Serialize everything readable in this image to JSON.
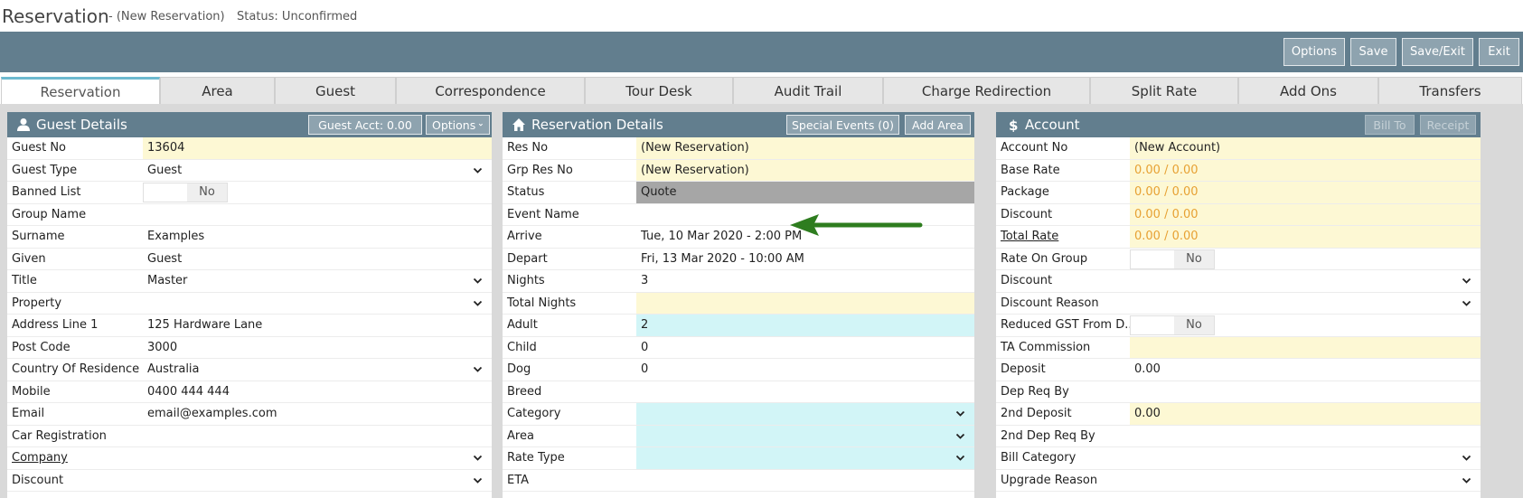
{
  "header": {
    "title": "Reservation",
    "subtitle": "- (New Reservation)",
    "status": "Status: Unconfirmed"
  },
  "toolbar": {
    "options": "Options",
    "save": "Save",
    "save_exit": "Save/Exit",
    "exit": "Exit"
  },
  "tabs": [
    "Reservation",
    "Area",
    "Guest",
    "Correspondence",
    "Tour Desk",
    "Audit Trail",
    "Charge Redirection",
    "Split Rate",
    "Add Ons",
    "Transfers"
  ],
  "guest_panel": {
    "title": "Guest Details",
    "acct_button": "Guest Acct: 0.00",
    "options_button": "Options",
    "rows": [
      {
        "label": "Guest No",
        "value": "13604"
      },
      {
        "label": "Guest Type",
        "value": "Guest"
      },
      {
        "label": "Banned List",
        "value": "No"
      },
      {
        "label": "Group Name",
        "value": ""
      },
      {
        "label": "Surname",
        "value": "Examples"
      },
      {
        "label": "Given",
        "value": "Guest"
      },
      {
        "label": "Title",
        "value": "Master"
      },
      {
        "label": "Property",
        "value": ""
      },
      {
        "label": "Address Line 1",
        "value": "125 Hardware Lane"
      },
      {
        "label": "Post Code",
        "value": "3000"
      },
      {
        "label": "Country Of Residence",
        "value": "Australia"
      },
      {
        "label": "Mobile",
        "value": "0400 444 444"
      },
      {
        "label": "Email",
        "value": "email@examples.com"
      },
      {
        "label": "Car Registration",
        "value": ""
      },
      {
        "label": "Company",
        "value": ""
      },
      {
        "label": "Discount",
        "value": ""
      }
    ]
  },
  "reservation_panel": {
    "title": "Reservation Details",
    "events_button": "Special Events (0)",
    "add_area_button": "Add Area",
    "rows": [
      {
        "label": "Res No",
        "value": "(New Reservation)"
      },
      {
        "label": "Grp Res No",
        "value": "(New Reservation)"
      },
      {
        "label": "Status",
        "value": "Quote"
      },
      {
        "label": "Event Name",
        "value": ""
      },
      {
        "label": "Arrive",
        "value": "Tue, 10 Mar 2020 - 2:00 PM"
      },
      {
        "label": "Depart",
        "value": "Fri, 13 Mar 2020 - 10:00 AM"
      },
      {
        "label": "Nights",
        "value": "3"
      },
      {
        "label": "Total Nights",
        "value": ""
      },
      {
        "label": "Adult",
        "value": "2"
      },
      {
        "label": "Child",
        "value": "0"
      },
      {
        "label": "Dog",
        "value": "0"
      },
      {
        "label": "Breed",
        "value": ""
      },
      {
        "label": "Category",
        "value": ""
      },
      {
        "label": "Area",
        "value": ""
      },
      {
        "label": "Rate Type",
        "value": ""
      },
      {
        "label": "ETA",
        "value": ""
      }
    ]
  },
  "account_panel": {
    "title": "Account",
    "bill_to_button": "Bill To",
    "receipt_button": "Receipt",
    "rows": [
      {
        "label": "Account No",
        "value": "(New Account)"
      },
      {
        "label": "Base Rate",
        "value": "0.00 / 0.00"
      },
      {
        "label": "Package",
        "value": "0.00 / 0.00"
      },
      {
        "label": "Discount",
        "value": "0.00 / 0.00"
      },
      {
        "label": "Total Rate",
        "value": "0.00 / 0.00"
      },
      {
        "label": "Rate On Group",
        "value": "No"
      },
      {
        "label": "Discount",
        "value": ""
      },
      {
        "label": "Discount Reason",
        "value": ""
      },
      {
        "label": "Reduced GST From D...",
        "value": "No"
      },
      {
        "label": "TA Commission",
        "value": ""
      },
      {
        "label": "Deposit",
        "value": "0.00"
      },
      {
        "label": "Dep Req By",
        "value": ""
      },
      {
        "label": "2nd Deposit",
        "value": "0.00"
      },
      {
        "label": "2nd Dep Req By",
        "value": ""
      },
      {
        "label": "Bill Category",
        "value": ""
      },
      {
        "label": "Upgrade Reason",
        "value": ""
      }
    ]
  },
  "colors": {
    "toolbar": "#627e8e",
    "button": "#8ea3af",
    "highlight_yellow": "#fdf8d4",
    "highlight_cyan": "#d2f5f7",
    "status_grey": "#a6a6a6",
    "rate_orange": "#e7a133",
    "arrow_green": "#2e7d1f"
  },
  "icons": {
    "guest": "user-icon",
    "reservation": "home-icon",
    "account": "dollar-icon",
    "dropdown": "chevron-down-icon",
    "annotation": "arrow-left-icon"
  }
}
